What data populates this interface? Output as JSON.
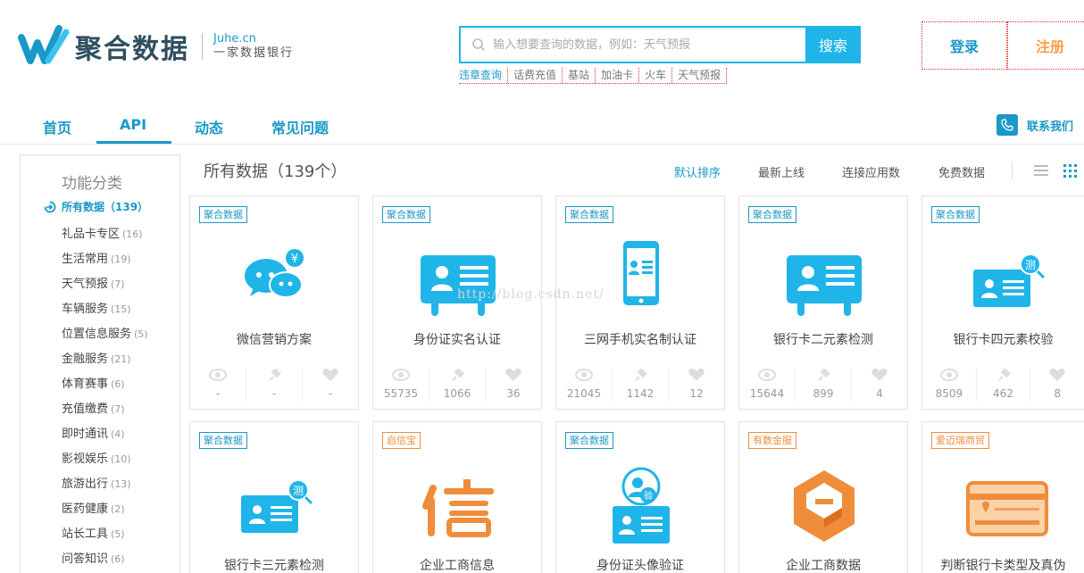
{
  "brand": {
    "name": "聚合数据",
    "domain": "Juhe.cn",
    "slogan": "一家数据银行",
    "accent": "#1a98c8",
    "orange": "#f08d3b"
  },
  "search": {
    "placeholder": "输入想要查询的数据，例如：天气预报",
    "button": "搜索",
    "hot_links": [
      "违章查询",
      "话费充值",
      "基站",
      "加油卡",
      "火车",
      "天气预报"
    ]
  },
  "auth": {
    "login": "登录",
    "register": "注册"
  },
  "nav": {
    "items": [
      "首页",
      "API",
      "动态",
      "常见问题"
    ],
    "active": "API",
    "contact": "联系我们"
  },
  "sidebar": {
    "title": "功能分类",
    "all_label": "所有数据（139）",
    "categories": [
      {
        "label": "礼品卡专区",
        "count": "(16)"
      },
      {
        "label": "生活常用",
        "count": "(19)"
      },
      {
        "label": "天气预报",
        "count": "(7)"
      },
      {
        "label": "车辆服务",
        "count": "(15)"
      },
      {
        "label": "位置信息服务",
        "count": "(5)"
      },
      {
        "label": "金融服务",
        "count": "(21)"
      },
      {
        "label": "体育赛事",
        "count": "(6)"
      },
      {
        "label": "充值缴费",
        "count": "(7)"
      },
      {
        "label": "即时通讯",
        "count": "(4)"
      },
      {
        "label": "影视娱乐",
        "count": "(10)"
      },
      {
        "label": "旅游出行",
        "count": "(13)"
      },
      {
        "label": "医药健康",
        "count": "(2)"
      },
      {
        "label": "站长工具",
        "count": "(5)"
      },
      {
        "label": "问答知识",
        "count": "(6)"
      }
    ]
  },
  "list": {
    "title": "所有数据（139个）",
    "sort": [
      "默认排序",
      "最新上线",
      "连接应用数",
      "免费数据"
    ],
    "sort_active": "默认排序"
  },
  "cards": [
    {
      "tag": "聚合数据",
      "tag_color": "blue",
      "name": "微信营销方案",
      "icon": "wechat-icon",
      "views": "-",
      "apps": "-",
      "likes": "-"
    },
    {
      "tag": "聚合数据",
      "tag_color": "blue",
      "name": "身份证实名认证",
      "icon": "id-card-icon",
      "views": "55735",
      "apps": "1066",
      "likes": "36"
    },
    {
      "tag": "聚合数据",
      "tag_color": "blue",
      "name": "三网手机实名制认证",
      "icon": "phone-id-icon",
      "views": "21045",
      "apps": "1142",
      "likes": "12"
    },
    {
      "tag": "聚合数据",
      "tag_color": "blue",
      "name": "银行卡二元素检测",
      "icon": "id-card-icon",
      "views": "15644",
      "apps": "899",
      "likes": "4"
    },
    {
      "tag": "聚合数据",
      "tag_color": "blue",
      "name": "银行卡四元素校验",
      "icon": "card-check-icon",
      "views": "8509",
      "apps": "462",
      "likes": "8"
    },
    {
      "tag": "聚合数据",
      "tag_color": "blue",
      "name": "银行卡三元素检测",
      "icon": "card-check-icon",
      "views": "",
      "apps": "",
      "likes": ""
    },
    {
      "tag": "启信宝",
      "tag_color": "orange",
      "name": "企业工商信息",
      "icon": "xin-logo-icon",
      "views": "",
      "apps": "",
      "likes": ""
    },
    {
      "tag": "聚合数据",
      "tag_color": "blue",
      "name": "身份证头像验证",
      "icon": "face-verify-icon",
      "views": "",
      "apps": "",
      "likes": ""
    },
    {
      "tag": "有数金服",
      "tag_color": "orange",
      "name": "企业工商数据",
      "icon": "hex-logo-icon",
      "views": "",
      "apps": "",
      "likes": ""
    },
    {
      "tag": "爱迈瑞商贸",
      "tag_color": "orange",
      "name": "判断银行卡类型及真伪",
      "icon": "bank-card-icon",
      "views": "",
      "apps": "",
      "likes": ""
    }
  ],
  "watermark": "http://blog.csdn.net/"
}
